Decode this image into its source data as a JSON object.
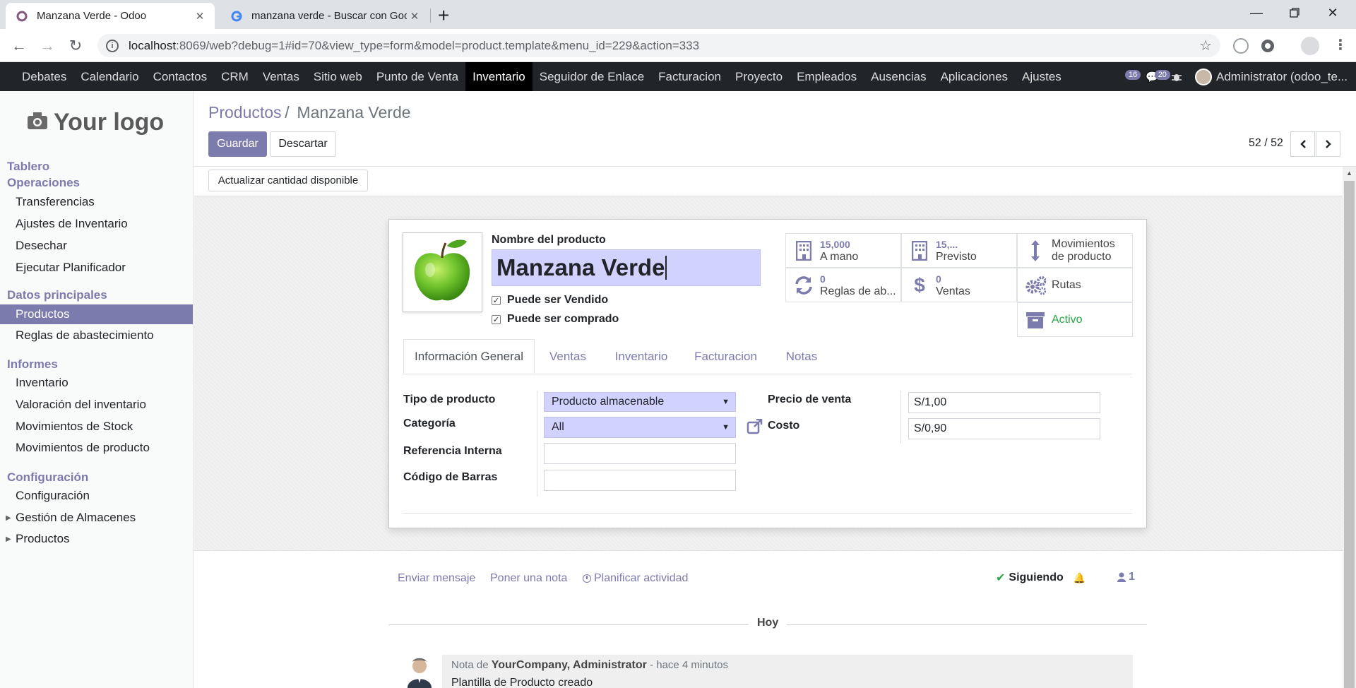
{
  "browser": {
    "tabs": [
      {
        "title": "Manzana Verde - Odoo",
        "active": true
      },
      {
        "title": "manzana verde - Buscar con Google",
        "active": false
      }
    ],
    "new_tab": "+",
    "url_host": "localhost",
    "url_path": ":8069/web?debug=1#id=70&view_type=form&model=product.template&menu_id=229&action=333"
  },
  "topnav": {
    "items": [
      "Debates",
      "Calendario",
      "Contactos",
      "CRM",
      "Ventas",
      "Sitio web",
      "Punto de Venta",
      "Inventario",
      "Seguidor de Enlace",
      "Facturacion",
      "Proyecto",
      "Empleados",
      "Ausencias",
      "Aplicaciones",
      "Ajustes"
    ],
    "active_index": 7,
    "activity_count": "16",
    "message_count": "20",
    "user": "Administrator (odoo_te..."
  },
  "sidebar": {
    "logo": "Your logo",
    "tablero": "Tablero",
    "sections": [
      {
        "title": "Operaciones",
        "items": [
          "Transferencias",
          "Ajustes de Inventario",
          "Desechar",
          "Ejecutar Planificador"
        ]
      },
      {
        "title": "Datos principales",
        "items": [
          "Productos",
          "Reglas de abastecimiento"
        ]
      },
      {
        "title": "Informes",
        "items": [
          "Inventario",
          "Valoración del inventario",
          "Movimientos de Stock",
          "Movimientos de producto"
        ]
      },
      {
        "title": "Configuración",
        "items": [
          "Configuración",
          "Gestión de Almacenes",
          "Productos"
        ]
      }
    ]
  },
  "control": {
    "breadcrumb_parent": "Productos",
    "breadcrumb_sep": "/",
    "breadcrumb_current": "Manzana Verde",
    "save": "Guardar",
    "discard": "Descartar",
    "pager": "52 / 52",
    "update_qty": "Actualizar cantidad disponible"
  },
  "form": {
    "name_label": "Nombre del producto",
    "name_value": "Manzana Verde",
    "can_be_sold": "Puede ser Vendido",
    "can_be_purchased": "Puede ser comprado",
    "stats": {
      "on_hand_value": "15,000",
      "on_hand_label": "A mano",
      "forecast_value": "15,...",
      "forecast_label": "Previsto",
      "moves_label_1": "Movimientos",
      "moves_label_2": "de producto",
      "rules_value": "0",
      "rules_label": "Reglas de ab...",
      "sales_value": "0",
      "sales_label": "Ventas",
      "routes_label": "Rutas",
      "active_label": "Activo"
    },
    "tabs": [
      "Información General",
      "Ventas",
      "Inventario",
      "Facturacion",
      "Notas"
    ],
    "fields": {
      "type_label": "Tipo de producto",
      "type_value": "Producto almacenable",
      "category_label": "Categoría",
      "category_value": "All",
      "ref_label": "Referencia Interna",
      "ref_value": "",
      "barcode_label": "Código de Barras",
      "barcode_value": "",
      "price_label": "Precio de venta",
      "price_value": "S/1,00",
      "cost_label": "Costo",
      "cost_value": "S/0,90"
    }
  },
  "chatter": {
    "send_message": "Enviar mensaje",
    "log_note": "Poner una nota",
    "schedule": "Planificar actividad",
    "following": "Siguiendo",
    "followers": "1",
    "day": "Hoy",
    "note_prefix": "Nota de",
    "author": "YourCompany, Administrator",
    "when": "- hace 4 minutos",
    "body": "Plantilla de Producto creado"
  },
  "colors": {
    "brand": "#7c7bad",
    "nav_bg": "#212529",
    "active_green": "#28a745"
  }
}
